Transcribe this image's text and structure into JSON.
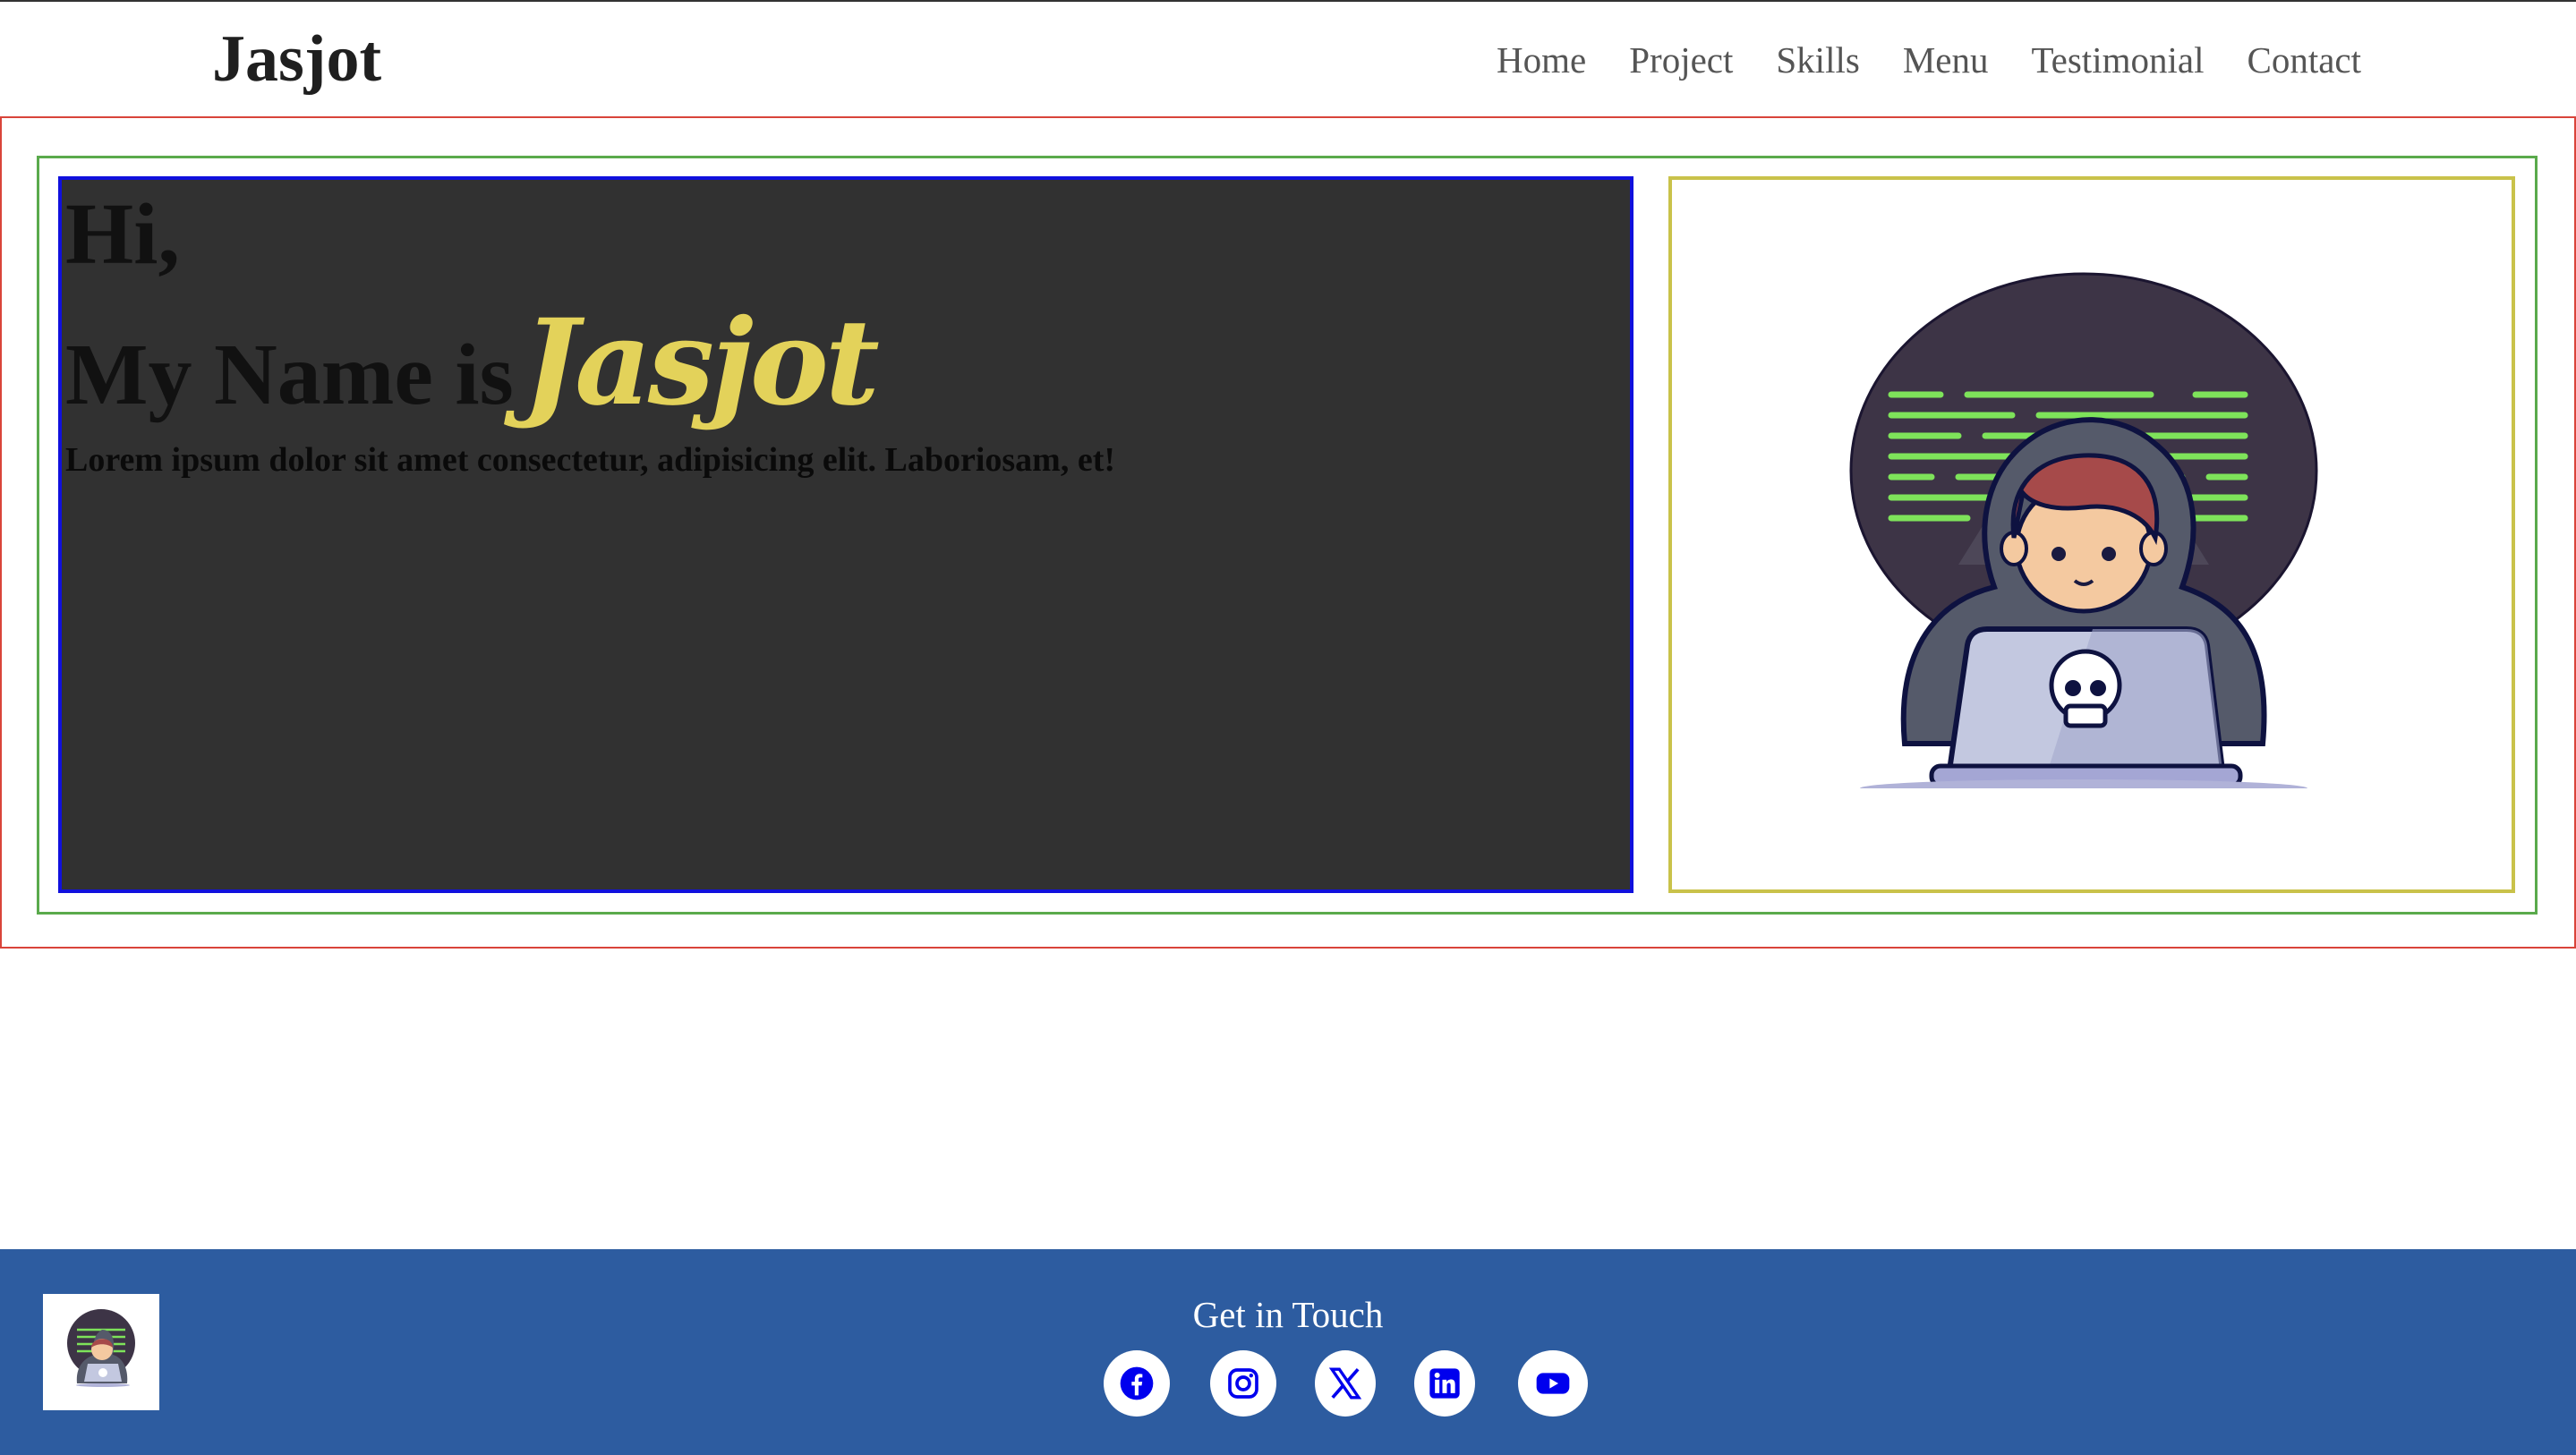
{
  "header": {
    "brand": "Jasjot",
    "nav": [
      "Home",
      "Project",
      "Skills",
      "Menu",
      "Testimonial",
      "Contact"
    ]
  },
  "hero": {
    "greeting": "Hi,",
    "name_prefix": "My Name is",
    "name_accent": "Jasjot",
    "description": "Lorem ipsum dolor sit amet consectetur, adipisicing elit. Laboriosam, et!"
  },
  "illustration": {
    "icon": "hacker-boy-laptop-skull-icon"
  },
  "footer": {
    "heading": "Get in Touch",
    "socials": [
      "facebook-icon",
      "instagram-icon",
      "x-icon",
      "linkedin-icon",
      "youtube-icon"
    ]
  },
  "colors": {
    "accent": "#e3d25a",
    "footer_bg": "#2d5ca0",
    "hero_bg": "#313131",
    "social_icon": "#0000ee"
  }
}
